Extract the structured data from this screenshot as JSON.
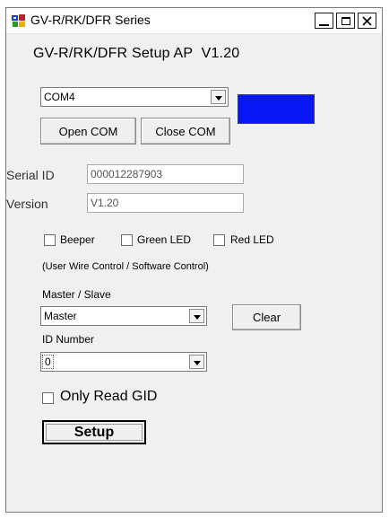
{
  "window": {
    "title": "GV-R/RK/DFR Series"
  },
  "header": {
    "title": "GV-R/RK/DFR Setup AP",
    "version": "V1.20"
  },
  "com": {
    "selected": "COM4",
    "status_color": "#0a17f5",
    "open_label": "Open COM",
    "close_label": "Close COM"
  },
  "info": {
    "serial_label": "Serial ID",
    "serial_value": "000012287903",
    "version_label": "Version",
    "version_value": "V1.20"
  },
  "options": {
    "beeper_label": "Beeper",
    "green_led_label": "Green LED",
    "red_led_label": "Red LED",
    "note": "(User Wire Control / Software Control)"
  },
  "mode": {
    "label": "Master / Slave",
    "selected": "Master",
    "clear_label": "Clear"
  },
  "id": {
    "label": "ID Number",
    "selected": "0"
  },
  "read": {
    "label": "Only Read  GID"
  },
  "actions": {
    "setup_label": "Setup"
  }
}
